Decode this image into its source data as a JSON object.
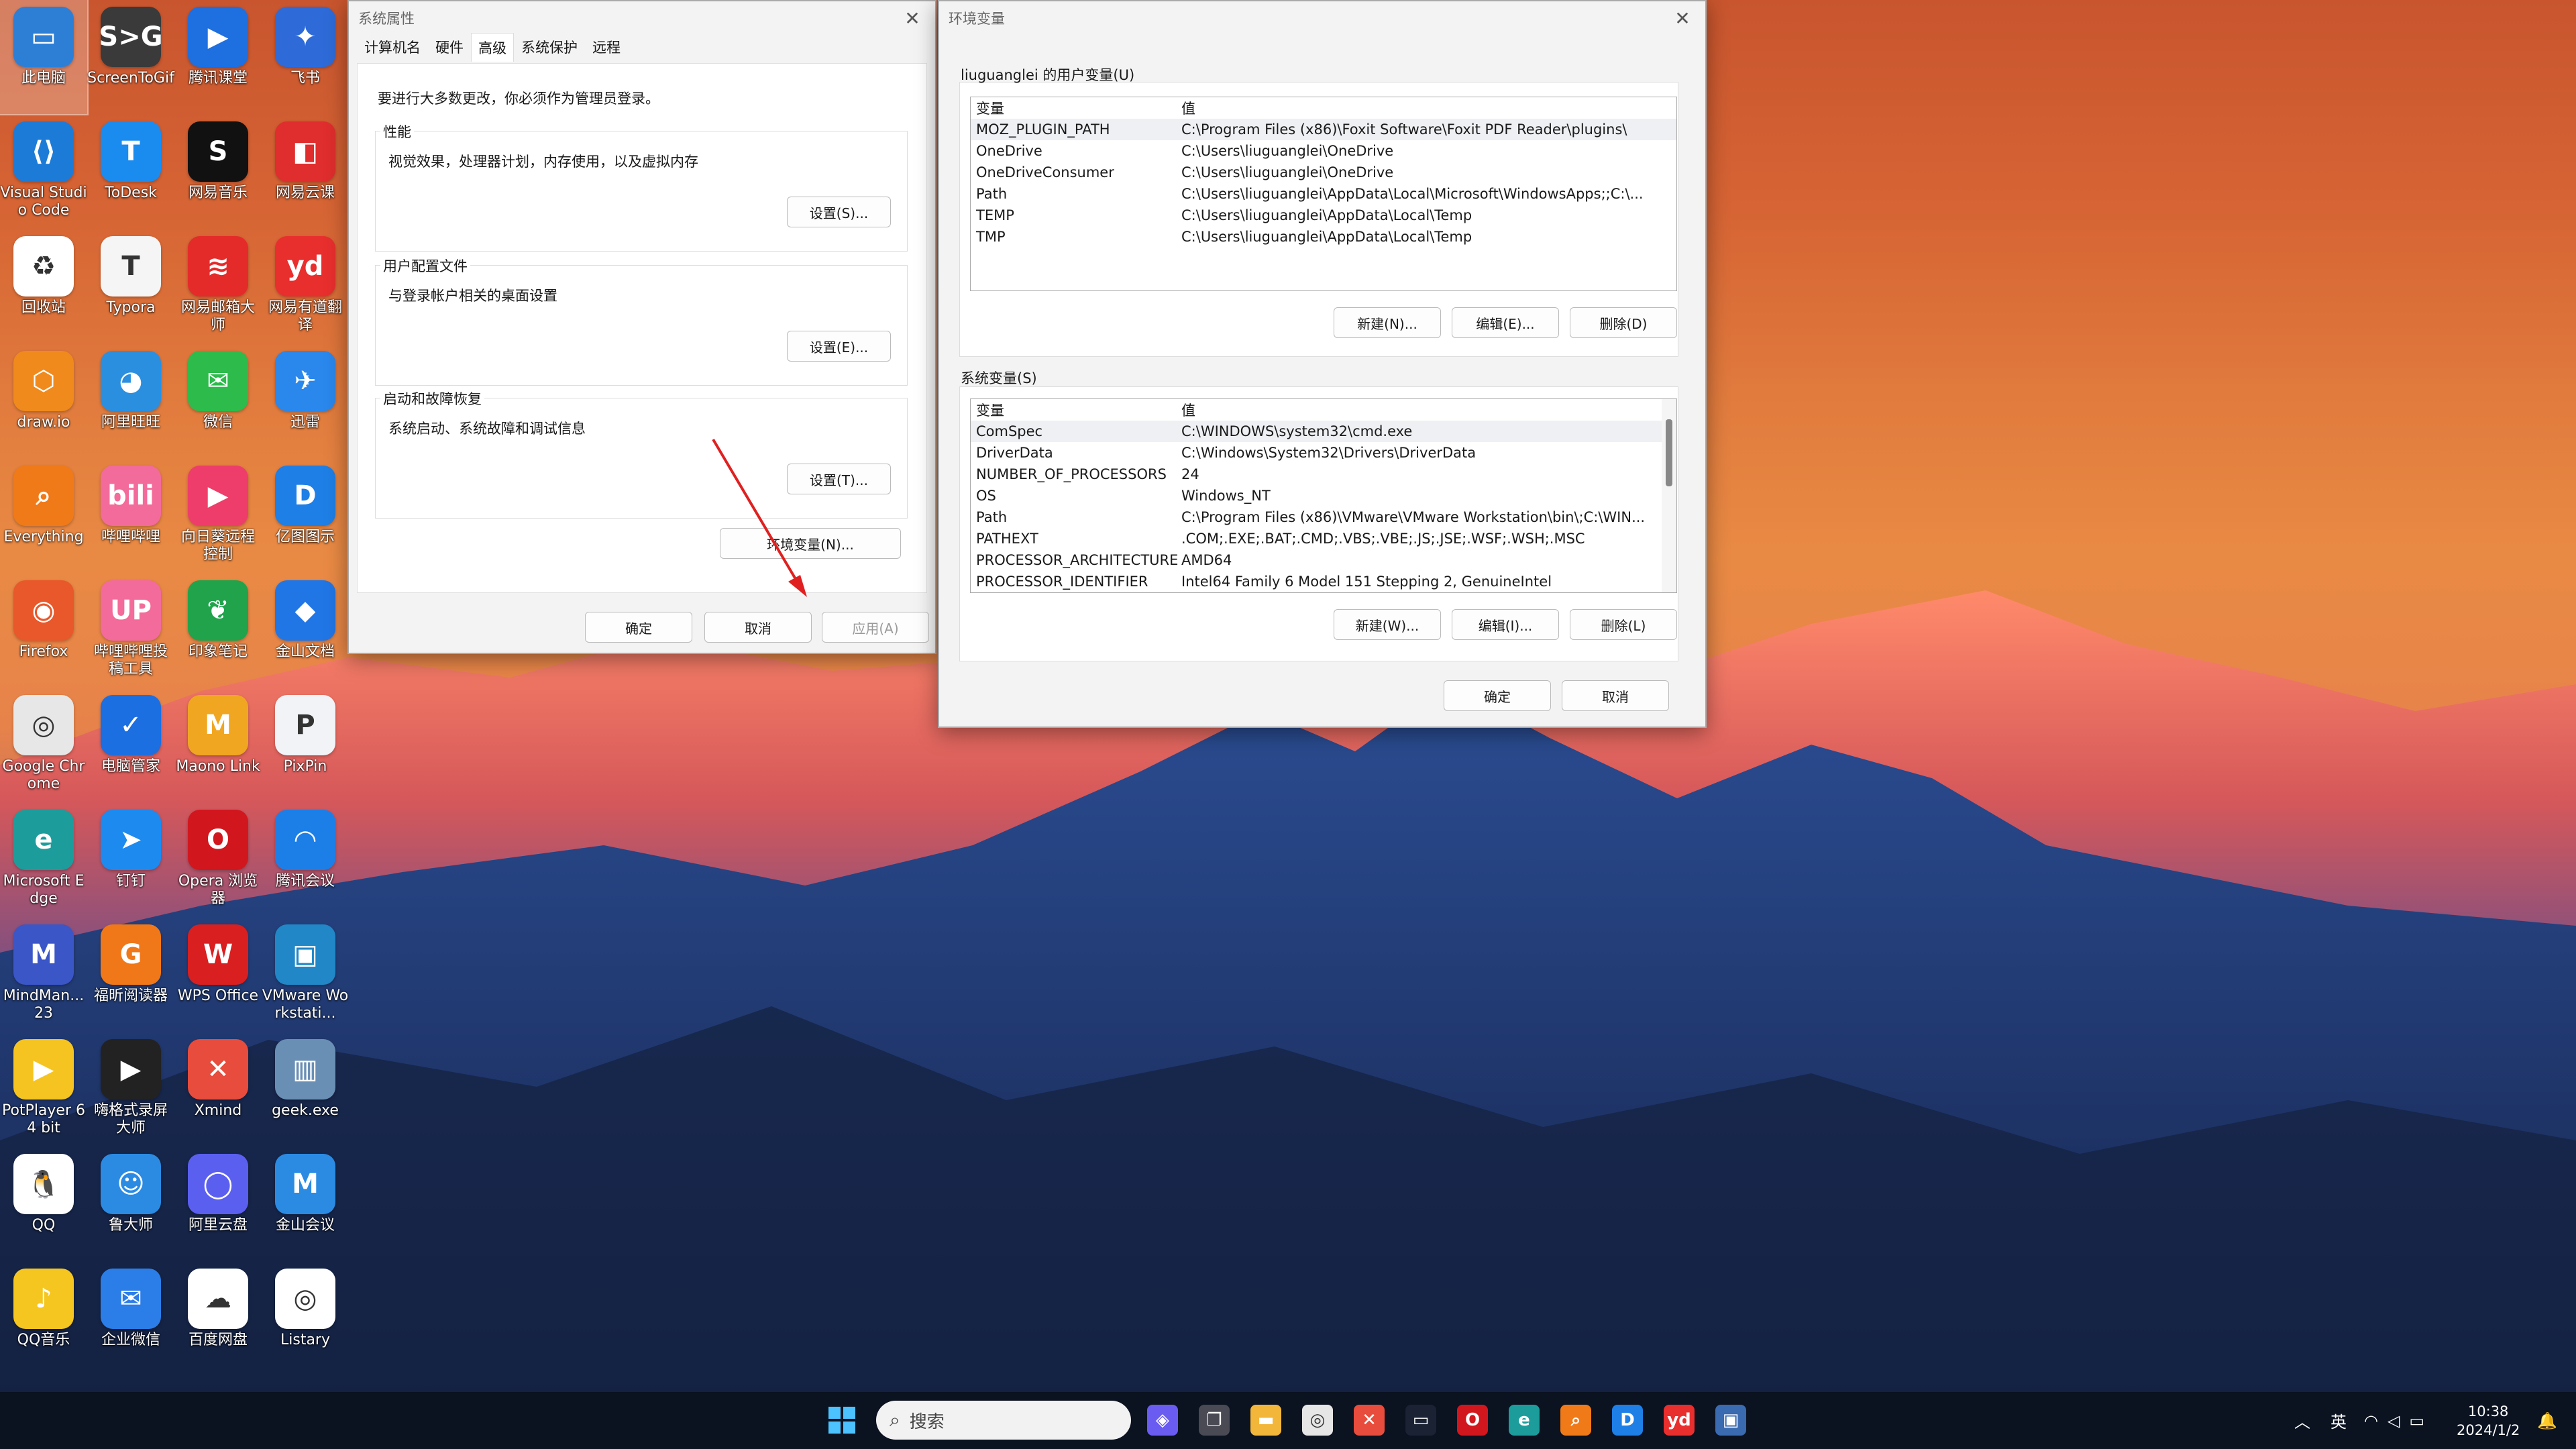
{
  "desktop": {
    "icons": [
      {
        "label": "此电脑",
        "color": "#2d7fd6",
        "glyph": "▭"
      },
      {
        "label": "ScreenToGif",
        "color": "#3a3a3a",
        "glyph": "S>G"
      },
      {
        "label": "腾讯课堂",
        "color": "#1e6fe0",
        "glyph": "▶"
      },
      {
        "label": "飞书",
        "color": "#2e6bd8",
        "glyph": "✦"
      },
      {
        "label": "Visual Studio Code",
        "color": "#1d7bd8",
        "glyph": "⟨⟩"
      },
      {
        "label": "ToDesk",
        "color": "#1a8cf0",
        "glyph": "T"
      },
      {
        "label": "网易音乐",
        "color": "#111111",
        "glyph": "S"
      },
      {
        "label": "网易云课",
        "color": "#e02d2d",
        "glyph": "◧"
      },
      {
        "label": "回收站",
        "color": "#ffffff",
        "glyph": "♻"
      },
      {
        "label": "Typora",
        "color": "#f5f5f5",
        "glyph": "T"
      },
      {
        "label": "网易邮箱大师",
        "color": "#e52a2a",
        "glyph": "≋"
      },
      {
        "label": "网易有道翻译",
        "color": "#e92e2e",
        "glyph": "yd"
      },
      {
        "label": "draw.io",
        "color": "#f08a1c",
        "glyph": "⬡"
      },
      {
        "label": "阿里旺旺",
        "color": "#2b8fe0",
        "glyph": "◕"
      },
      {
        "label": "微信",
        "color": "#2dbb4b",
        "glyph": "✉"
      },
      {
        "label": "迅雷",
        "color": "#2a87ec",
        "glyph": "✈"
      },
      {
        "label": "Everything",
        "color": "#f07a18",
        "glyph": "⌕"
      },
      {
        "label": "哔哩哔哩",
        "color": "#f36b9a",
        "glyph": "bili"
      },
      {
        "label": "向日葵远程控制",
        "color": "#ee3d6a",
        "glyph": "▶"
      },
      {
        "label": "亿图图示",
        "color": "#1e7fe6",
        "glyph": "D"
      },
      {
        "label": "Firefox",
        "color": "#e8582a",
        "glyph": "◉"
      },
      {
        "label": "哔哩哔哩投稿工具",
        "color": "#f36b9a",
        "glyph": "UP"
      },
      {
        "label": "印象笔记",
        "color": "#20a34b",
        "glyph": "❦"
      },
      {
        "label": "金山文档",
        "color": "#2176e6",
        "glyph": "◆"
      },
      {
        "label": "Google Chrome",
        "color": "#e7e7e7",
        "glyph": "◎"
      },
      {
        "label": "电脑管家",
        "color": "#1c6fe0",
        "glyph": "✓"
      },
      {
        "label": "Maono Link",
        "color": "#f1a622",
        "glyph": "M"
      },
      {
        "label": "PixPin",
        "color": "#f1f3f7",
        "glyph": "P"
      },
      {
        "label": "Microsoft Edge",
        "color": "#1d9c9c",
        "glyph": "e"
      },
      {
        "label": "钉钉",
        "color": "#1d8af0",
        "glyph": "➤"
      },
      {
        "label": "Opera 浏览器",
        "color": "#d2161e",
        "glyph": "O"
      },
      {
        "label": "腾讯会议",
        "color": "#1c7fe8",
        "glyph": "◠"
      },
      {
        "label": "MindMan...23",
        "color": "#3b56c7",
        "glyph": "M"
      },
      {
        "label": "福昕阅读器",
        "color": "#f07818",
        "glyph": "G"
      },
      {
        "label": "WPS Office",
        "color": "#d91f1f",
        "glyph": "W"
      },
      {
        "label": "VMware Workstati...",
        "color": "#2187c7",
        "glyph": "▣"
      },
      {
        "label": "PotPlayer 64 bit",
        "color": "#f5c420",
        "glyph": "▶"
      },
      {
        "label": "嗨格式录屏大师",
        "color": "#222222",
        "glyph": "▶"
      },
      {
        "label": "Xmind",
        "color": "#e84c3c",
        "glyph": "✕"
      },
      {
        "label": "geek.exe",
        "color": "#6a8fb5",
        "glyph": "▥"
      },
      {
        "label": "QQ",
        "color": "#ffffff",
        "glyph": "🐧"
      },
      {
        "label": "鲁大师",
        "color": "#2b8be3",
        "glyph": "☺"
      },
      {
        "label": "阿里云盘",
        "color": "#5b5ff0",
        "glyph": "◯"
      },
      {
        "label": "金山会议",
        "color": "#2b8be3",
        "glyph": "M"
      },
      {
        "label": "QQ音乐",
        "color": "#f5c620",
        "glyph": "♪"
      },
      {
        "label": "企业微信",
        "color": "#2b7de8",
        "glyph": "✉"
      },
      {
        "label": "百度网盘",
        "color": "#ffffff",
        "glyph": "☁"
      },
      {
        "label": "Listary",
        "color": "#ffffff",
        "glyph": "◎"
      }
    ]
  },
  "sysprops": {
    "title": "系统属性",
    "tabs": [
      "计算机名",
      "硬件",
      "高级",
      "系统保护",
      "远程"
    ],
    "admin_note": "要进行大多数更改，你必须作为管理员登录。",
    "performance": {
      "title": "性能",
      "desc": "视觉效果，处理器计划，内存使用，以及虚拟内存",
      "button": "设置(S)..."
    },
    "profile": {
      "title": "用户配置文件",
      "desc": "与登录帐户相关的桌面设置",
      "button": "设置(E)..."
    },
    "startup": {
      "title": "启动和故障恢复",
      "desc": "系统启动、系统故障和调试信息",
      "button": "设置(T)..."
    },
    "env_button": "环境变量(N)...",
    "ok": "确定",
    "cancel": "取消",
    "apply": "应用(A)"
  },
  "envvars": {
    "title": "环境变量",
    "user_section": "liuguanglei 的用户变量(U)",
    "col_var": "变量",
    "col_val": "值",
    "user_vars": [
      {
        "name": "MOZ_PLUGIN_PATH",
        "value": "C:\\Program Files (x86)\\Foxit Software\\Foxit PDF Reader\\plugins\\"
      },
      {
        "name": "OneDrive",
        "value": "C:\\Users\\liuguanglei\\OneDrive"
      },
      {
        "name": "OneDriveConsumer",
        "value": "C:\\Users\\liuguanglei\\OneDrive"
      },
      {
        "name": "Path",
        "value": "C:\\Users\\liuguanglei\\AppData\\Local\\Microsoft\\WindowsApps;;C:\\..."
      },
      {
        "name": "TEMP",
        "value": "C:\\Users\\liuguanglei\\AppData\\Local\\Temp"
      },
      {
        "name": "TMP",
        "value": "C:\\Users\\liuguanglei\\AppData\\Local\\Temp"
      }
    ],
    "user_buttons": {
      "new": "新建(N)...",
      "edit": "编辑(E)...",
      "delete": "删除(D)"
    },
    "sys_section": "系统变量(S)",
    "sys_vars": [
      {
        "name": "ComSpec",
        "value": "C:\\WINDOWS\\system32\\cmd.exe"
      },
      {
        "name": "DriverData",
        "value": "C:\\Windows\\System32\\Drivers\\DriverData"
      },
      {
        "name": "NUMBER_OF_PROCESSORS",
        "value": "24"
      },
      {
        "name": "OS",
        "value": "Windows_NT"
      },
      {
        "name": "Path",
        "value": "C:\\Program Files (x86)\\VMware\\VMware Workstation\\bin\\;C:\\WIN..."
      },
      {
        "name": "PATHEXT",
        "value": ".COM;.EXE;.BAT;.CMD;.VBS;.VBE;.JS;.JSE;.WSF;.WSH;.MSC"
      },
      {
        "name": "PROCESSOR_ARCHITECTURE",
        "value": "AMD64"
      },
      {
        "name": "PROCESSOR_IDENTIFIER",
        "value": "Intel64 Family 6 Model 151 Stepping 2, GenuineIntel"
      }
    ],
    "sys_buttons": {
      "new": "新建(W)...",
      "edit": "编辑(I)...",
      "delete": "删除(L)"
    },
    "ok": "确定",
    "cancel": "取消"
  },
  "taskbar": {
    "search_placeholder": "搜索",
    "apps": [
      {
        "name": "copilot-icon",
        "color": "#6a5cf0",
        "glyph": "◈"
      },
      {
        "name": "task-view-icon",
        "color": "#4a4a55",
        "glyph": "❐"
      },
      {
        "name": "file-explorer-icon",
        "color": "#f2b63a",
        "glyph": "▬"
      },
      {
        "name": "chrome-icon",
        "color": "#e6e6e6",
        "glyph": "◎"
      },
      {
        "name": "xmind-icon",
        "color": "#e84c3c",
        "glyph": "✕"
      },
      {
        "name": "camera-icon",
        "color": "#1a2233",
        "glyph": "▭"
      },
      {
        "name": "opera-icon",
        "color": "#d2161e",
        "glyph": "O"
      },
      {
        "name": "edge-icon",
        "color": "#1d9c9c",
        "glyph": "e"
      },
      {
        "name": "everything-icon",
        "color": "#f07a18",
        "glyph": "⌕"
      },
      {
        "name": "edraw-icon",
        "color": "#1e7fe6",
        "glyph": "D"
      },
      {
        "name": "youdao-icon",
        "color": "#e92e2e",
        "glyph": "yd"
      },
      {
        "name": "system-properties-icon",
        "color": "#3a6ab0",
        "glyph": "▣"
      }
    ],
    "ime": "英",
    "time": "10:38",
    "date": "2024/1/2"
  }
}
